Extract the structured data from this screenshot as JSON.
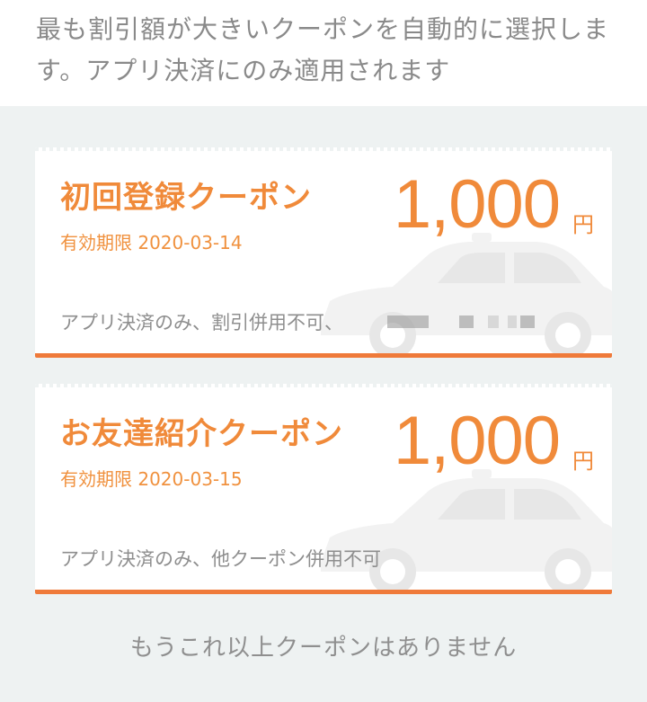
{
  "notice": "最も割引額が大きいクーポンを自動的に選択します。アプリ決済にのみ適用されます",
  "coupons": [
    {
      "title": "初回登録クーポン",
      "expiry": "有効期限 2020-03-14",
      "amount": "1,000",
      "unit": "円",
      "terms": "アプリ決済のみ、割引併用不可、"
    },
    {
      "title": "お友達紹介クーポン",
      "expiry": "有効期限 2020-03-15",
      "amount": "1,000",
      "unit": "円",
      "terms": "アプリ決済のみ、他クーポン併用不可"
    }
  ],
  "footer": "もうこれ以上クーポンはありません",
  "colors": {
    "accent": "#f08a3a",
    "bottom_border": "#ef7a3a",
    "background": "#eef2f2"
  },
  "icons": [
    "taxi-car-watermark"
  ]
}
